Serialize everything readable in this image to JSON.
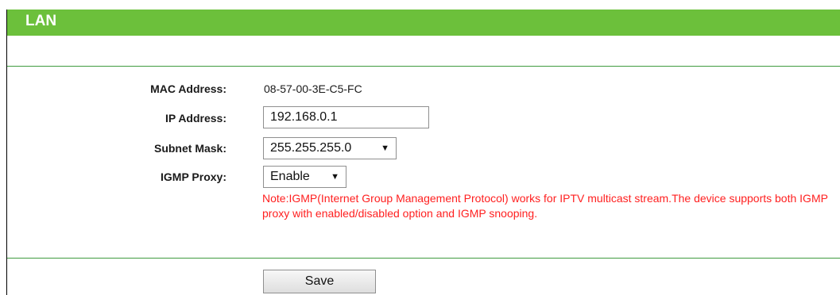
{
  "section": {
    "title": "LAN"
  },
  "fields": {
    "mac": {
      "label": "MAC Address:",
      "value": "08-57-00-3E-C5-FC"
    },
    "ip": {
      "label": "IP Address:",
      "value": "192.168.0.1"
    },
    "subnet": {
      "label": "Subnet Mask:",
      "value": "255.255.255.0"
    },
    "igmp": {
      "label": "IGMP Proxy:",
      "value": "Enable"
    }
  },
  "note": "Note:IGMP(Internet Group Management Protocol) works for IPTV multicast stream.The device supports both IGMP proxy with enabled/disabled option and IGMP snooping.",
  "actions": {
    "save_label": "Save"
  },
  "icons": {
    "dropdown": "chevron-down-icon"
  },
  "colors": {
    "header": "#6cc03b",
    "rule": "#3f9b3f",
    "note": "#ff1f1f"
  }
}
